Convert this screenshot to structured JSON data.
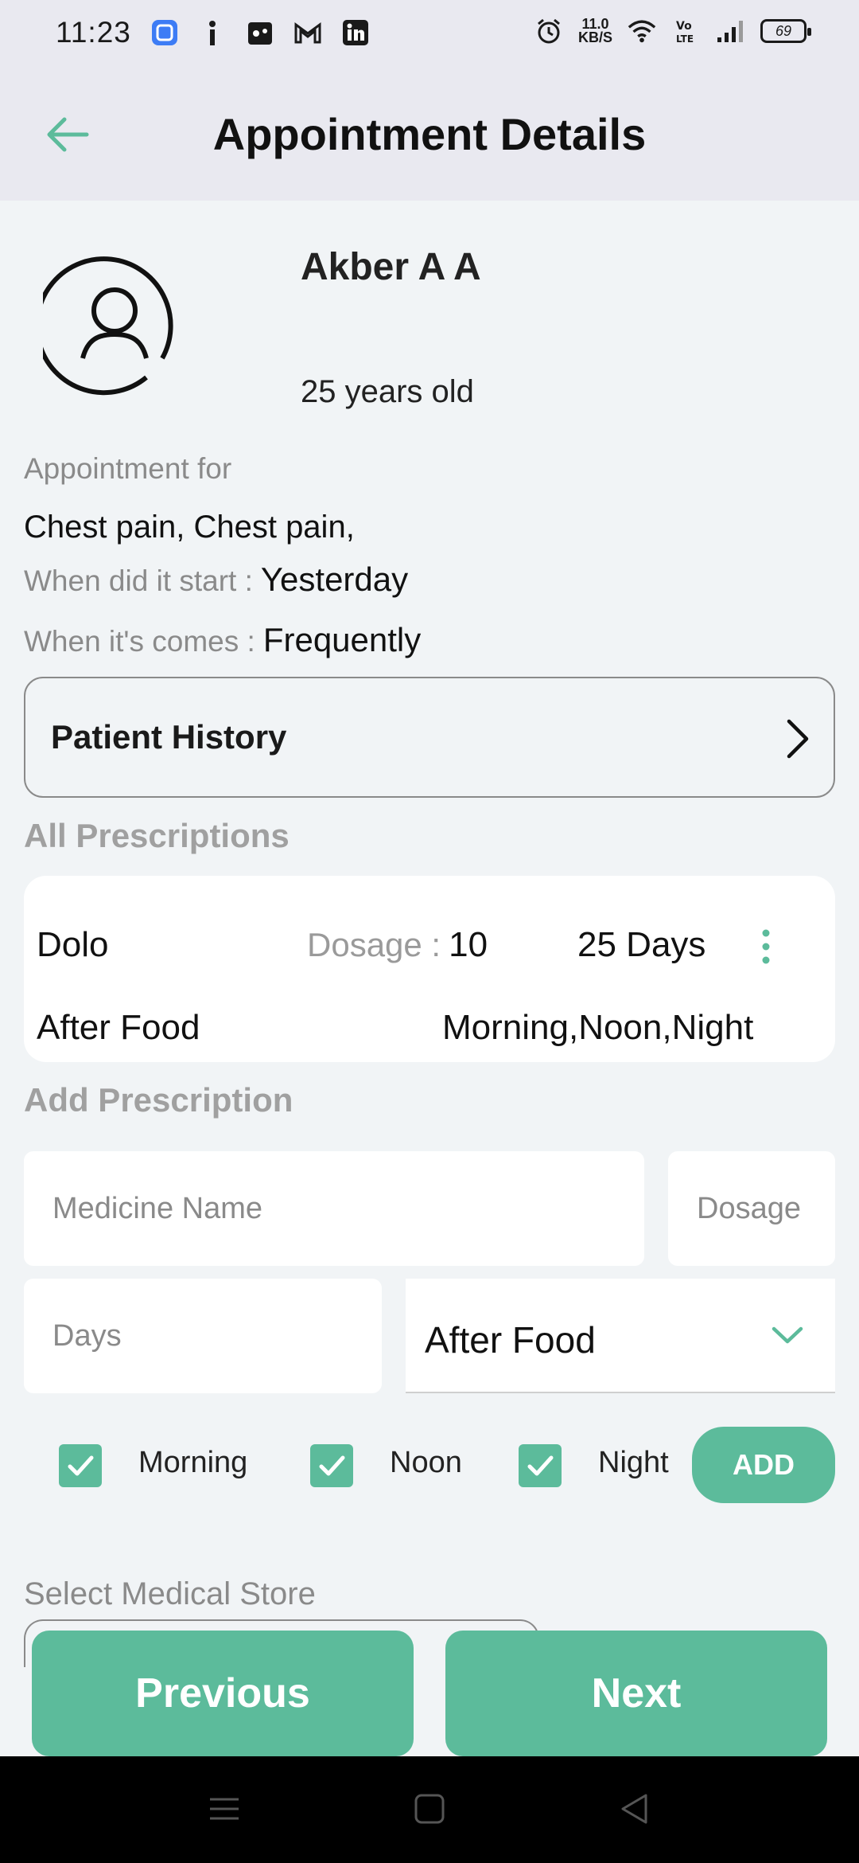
{
  "status_bar": {
    "time": "11:23",
    "net_speed_value": "11.0",
    "net_speed_unit": "KB/S",
    "battery": "69",
    "left_icons": [
      "app-icon",
      "info-icon",
      "game-icon",
      "gmail-icon",
      "linkedin-icon"
    ],
    "right_icons": [
      "alarm-icon",
      "wifi-icon",
      "volte-icon",
      "signal-icon",
      "battery-icon"
    ]
  },
  "app_bar": {
    "title": "Appointment Details"
  },
  "patient": {
    "name": "Akber A A",
    "age": "25 years old"
  },
  "appointment": {
    "for_label": "Appointment for",
    "for_value": "Chest pain, Chest pain,",
    "start_label": "When did it start :",
    "start_value": "Yesterday",
    "comes_label": "When it's comes :",
    "comes_value": "Frequently"
  },
  "history": {
    "label": "Patient History"
  },
  "prescriptions": {
    "title": "All Prescriptions",
    "items": [
      {
        "name": "Dolo",
        "dosage_label": "Dosage :",
        "dosage": "10",
        "days": "25 Days",
        "food": "After Food",
        "times": "Morning,Noon,Night"
      }
    ]
  },
  "add_prescription": {
    "title": "Add Prescription",
    "medicine_placeholder": "Medicine Name",
    "dosage_placeholder": "Dosage",
    "days_placeholder": "Days",
    "food_selected": "After Food",
    "morning_label": "Morning",
    "noon_label": "Noon",
    "night_label": "Night",
    "morning_checked": true,
    "noon_checked": true,
    "night_checked": true,
    "add_label": "ADD"
  },
  "medical_store": {
    "label": "Select Medical Store"
  },
  "footer": {
    "previous_label": "Previous",
    "next_label": "Next"
  },
  "colors": {
    "accent": "#5cbb9b",
    "app_bar_bg": "#e9e9f0",
    "page_bg": "#f1f4f6"
  }
}
